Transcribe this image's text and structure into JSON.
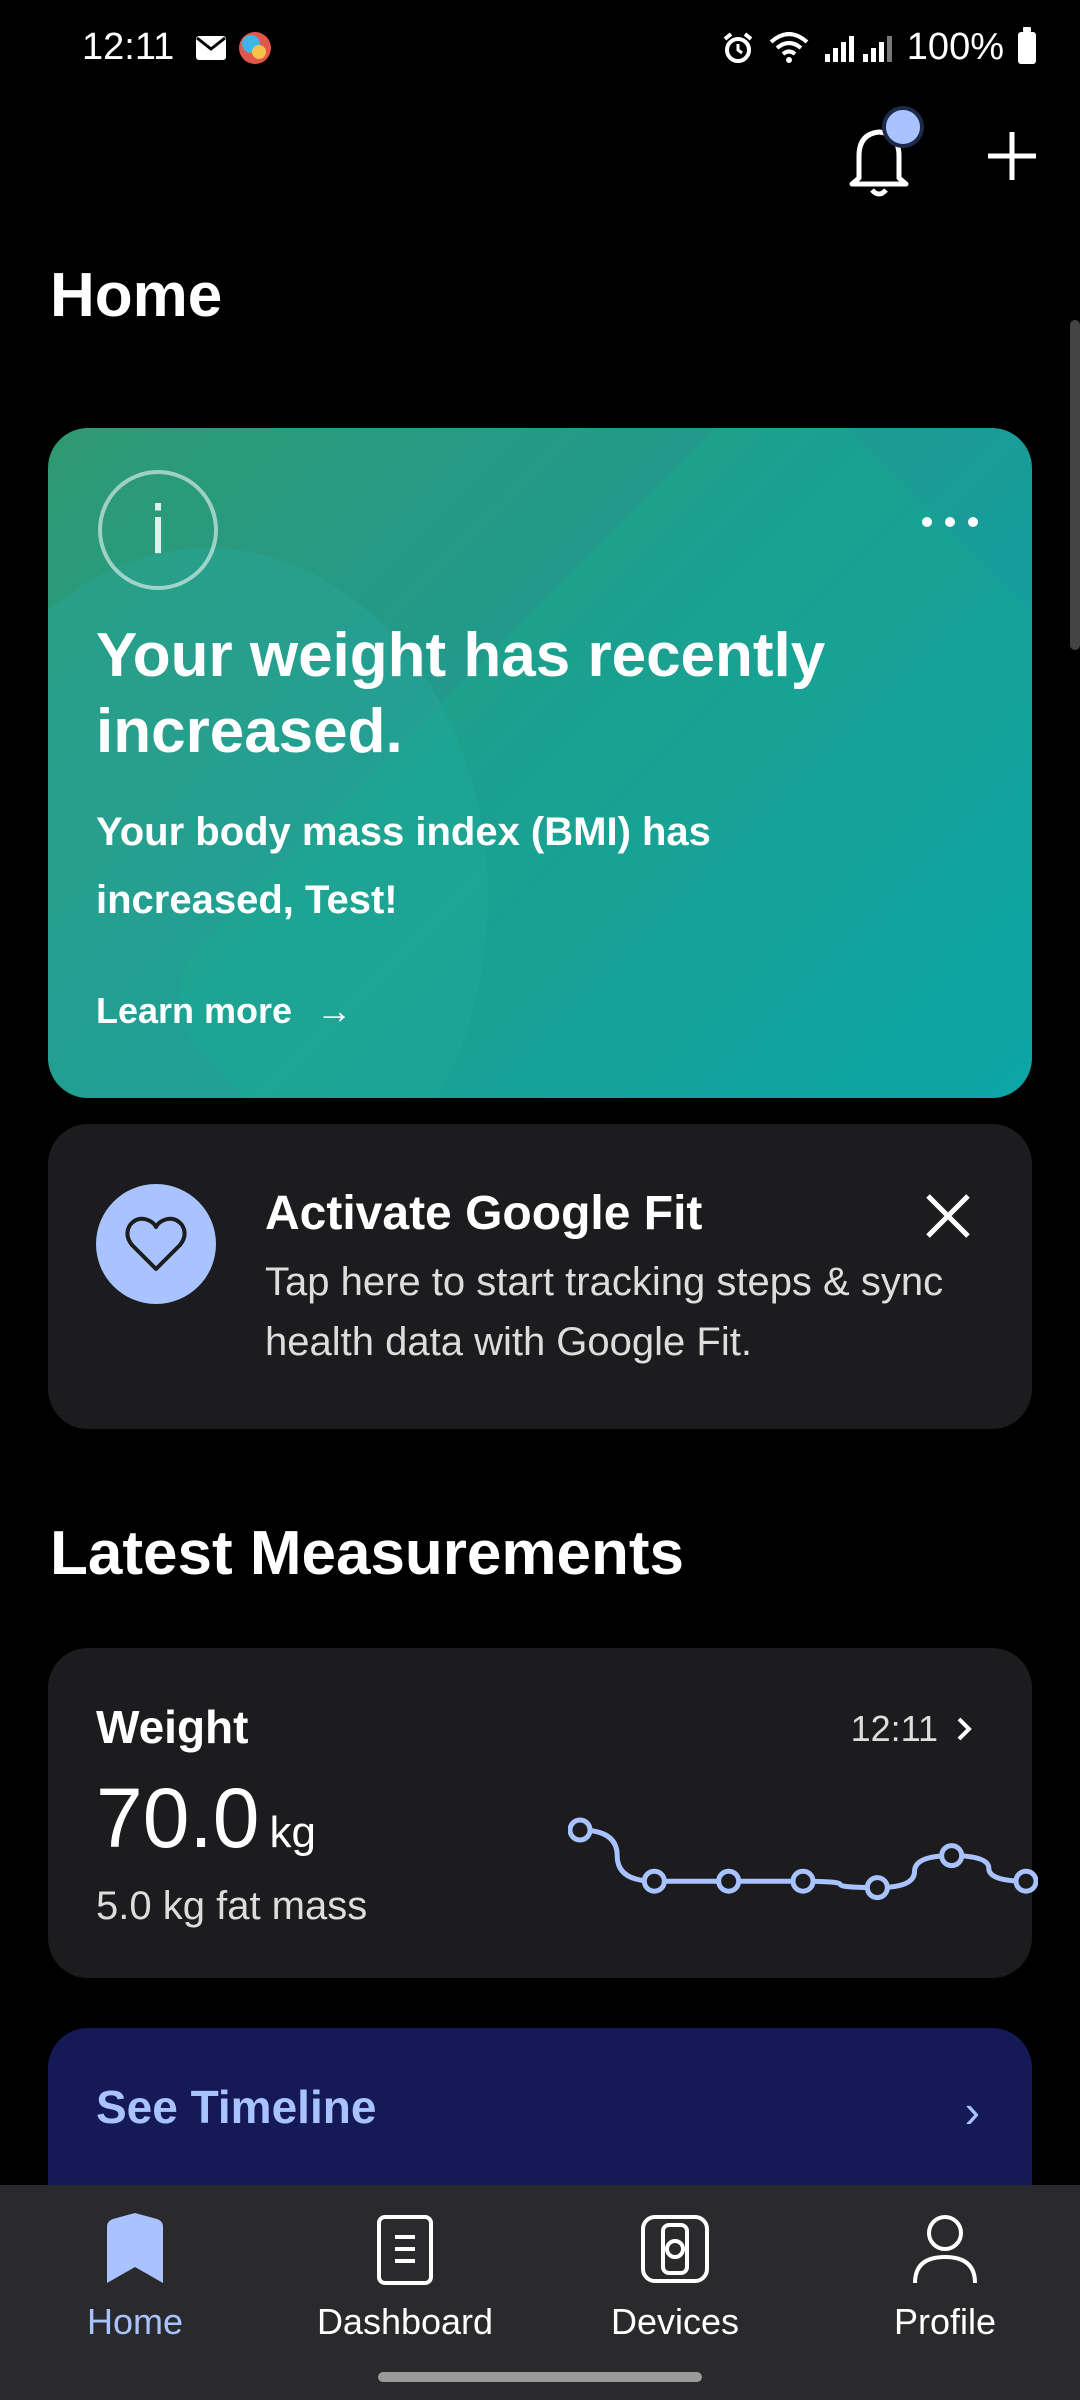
{
  "status_bar": {
    "time": "12:11",
    "battery": "100%",
    "icons": [
      "mail-icon",
      "app-icon",
      "alarm-icon",
      "wifi-icon",
      "signal-icon"
    ]
  },
  "header": {
    "title": "Home",
    "actions": [
      "bell-icon",
      "plus-icon"
    ]
  },
  "insight_card": {
    "title": "Your weight has recently increased.",
    "body": "Your body mass index (BMI) has increased, Test!",
    "link_label": "Learn more",
    "link_arrow": "→",
    "menu_icon": "more-icon"
  },
  "fit_card": {
    "title": "Activate Google Fit",
    "description": "Tap here to start tracking steps & sync health data with Google Fit."
  },
  "latest": {
    "section_title": "Latest Measurements",
    "weight": {
      "label": "Weight",
      "time": "12:11",
      "value": "70.0",
      "unit": "kg",
      "fat_mass": "5.0 kg fat mass",
      "trend": [
        70.4,
        69.6,
        69.6,
        69.6,
        69.5,
        70.0,
        69.6
      ]
    }
  },
  "timeline": {
    "label": "See Timeline",
    "chevron": "›"
  },
  "bottom_nav": {
    "items": [
      {
        "label": "Home",
        "icon": "home-icon",
        "active": true
      },
      {
        "label": "Dashboard",
        "icon": "dashboard-icon",
        "active": false
      },
      {
        "label": "Devices",
        "icon": "watch-icon",
        "active": false
      },
      {
        "label": "Profile",
        "icon": "profile-icon",
        "active": false
      }
    ]
  },
  "colors": {
    "accent": "#a8c3ff",
    "card": "#1c1c1e",
    "timeline_bg": "#151a57"
  }
}
